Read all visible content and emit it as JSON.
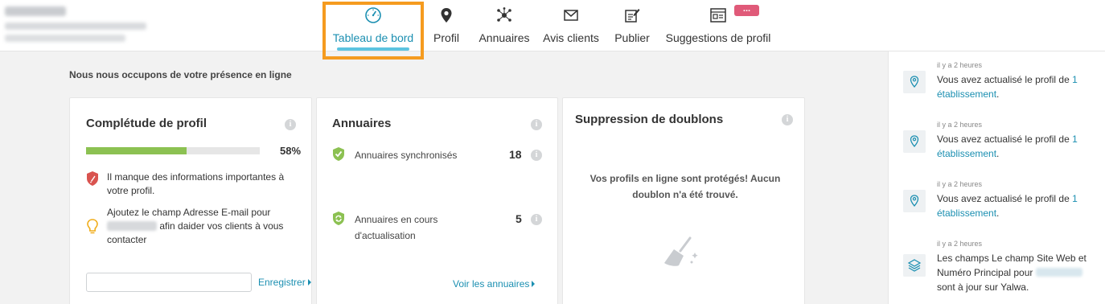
{
  "nav": {
    "items": [
      {
        "label": "Tableau de bord",
        "icon": "dashboard-gauge-icon"
      },
      {
        "label": "Profil",
        "icon": "map-pin-icon"
      },
      {
        "label": "Annuaires",
        "icon": "network-hub-icon"
      },
      {
        "label": "Avis clients",
        "icon": "envelope-icon"
      },
      {
        "label": "Publier",
        "icon": "publish-edit-icon"
      },
      {
        "label": "Suggestions de profil",
        "icon": "profile-card-icon"
      }
    ],
    "badge": "..."
  },
  "main": {
    "title": "Nous nous occupons de votre présence en ligne"
  },
  "completeness": {
    "title": "Complétude de profil",
    "info": "i",
    "progress": 58,
    "percent_label": "58%",
    "warning_text": "Il manque des informations importantes à votre profil.",
    "tip_prefix": "Ajoutez le champ Adresse E-mail pour",
    "tip_suffix": "afin daider vos clients à vous contacter",
    "save_label": "Enregistrer"
  },
  "directories": {
    "title": "Annuaires",
    "info": "i",
    "synced_label": "Annuaires synchronisés",
    "synced_count": "18",
    "updating_label": "Annuaires en cours d'actualisation",
    "updating_count": "5",
    "see_all_label": "Voir les annuaires"
  },
  "duplicates": {
    "title": "Suppression de doublons",
    "info": "i",
    "message": "Vos profils en ligne sont protégés! Aucun doublon n'a été trouvé."
  },
  "feed": {
    "items": [
      {
        "time": "il y a 2 heures",
        "text": "Vous avez actualisé le profil de ",
        "highlight": "1 établissement",
        "end": "."
      },
      {
        "time": "il y a 2 heures",
        "text": "Vous avez actualisé le profil de ",
        "highlight": "1 établissement",
        "end": "."
      },
      {
        "time": "il y a 2 heures",
        "text": "Vous avez actualisé le profil de ",
        "highlight": "1 établissement",
        "end": "."
      },
      {
        "time": "il y a 2 heures",
        "text": "Les champs Le champ Site Web et Numéro Principal pour",
        "end": "sont à jour sur Yalwa."
      }
    ]
  },
  "colors": {
    "accent": "#1b8fb1",
    "progress_green": "#8cc152",
    "highlight_orange": "#f59b1f",
    "badge_pink": "#e05a79"
  }
}
